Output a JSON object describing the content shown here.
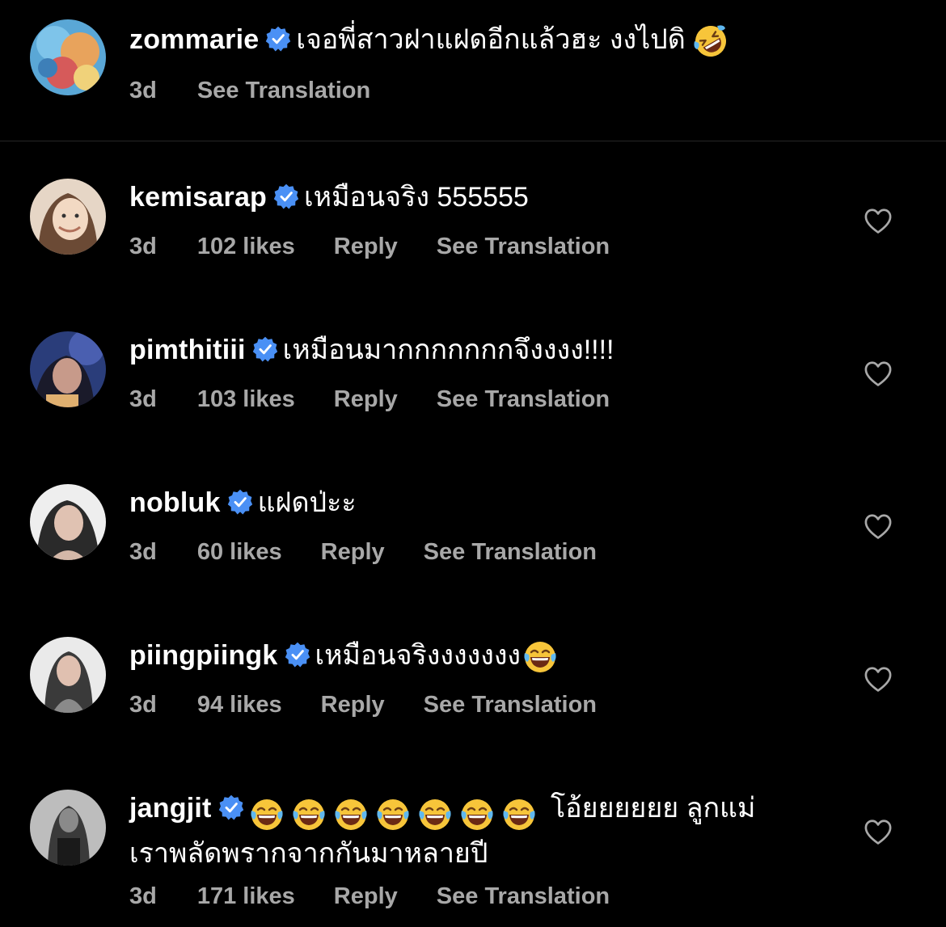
{
  "comments": [
    {
      "username": "zommarie",
      "text": "เจอพี่สาวฝาแฝดอีกแล้วฮะ งงไปดิ",
      "emoji": "rolling-on-floor-laughing-emoji",
      "time": "3d",
      "see_translation": "See Translation",
      "avatar_colors": [
        "#5aa7d6",
        "#e8a35c",
        "#d65a5a"
      ]
    },
    {
      "username": "kemisarap",
      "text": "เหมือนจริง 555555",
      "time": "3d",
      "likes": "102 likes",
      "reply": "Reply",
      "see_translation": "See Translation",
      "avatar_colors": [
        "#d9c7b8",
        "#f2e2d3",
        "#6b4a35"
      ]
    },
    {
      "username": "pimthitiii",
      "text": "เหมือนมากกกกกกกจึงงงง!!!!",
      "time": "3d",
      "likes": "103 likes",
      "reply": "Reply",
      "see_translation": "See Translation",
      "avatar_colors": [
        "#2a3d7a",
        "#c79a8a",
        "#4a5fb0"
      ]
    },
    {
      "username": "nobluk",
      "text": "แฝดป่ะะ",
      "time": "3d",
      "likes": "60 likes",
      "reply": "Reply",
      "see_translation": "See Translation",
      "avatar_colors": [
        "#e8e8e8",
        "#d4b8a8",
        "#2a2a2a"
      ]
    },
    {
      "username": "piingpiingk",
      "text": "เหมือนจริงงงงงงง",
      "emoji": "tears-of-joy-emoji",
      "time": "3d",
      "likes": "94 likes",
      "reply": "Reply",
      "see_translation": "See Translation",
      "avatar_colors": [
        "#eaeaea",
        "#c9a89a",
        "#3a3a3a"
      ]
    },
    {
      "username": "jangjit",
      "emoji_count": 7,
      "text": "โอ้ยยยยยย ลูกแม่เราพลัดพรากจากกันมาหลายปี",
      "time": "3d",
      "likes": "171 likes",
      "reply": "Reply",
      "see_translation": "See Translation",
      "avatar_colors": [
        "#bdbdbd",
        "#3a3a3a",
        "#7a7a7a"
      ]
    }
  ],
  "colors": {
    "background": "#000000",
    "meta": "#a8a8a8",
    "verified": "#4a90f5",
    "divider": "#262626"
  },
  "icons": {
    "verified": "verified-badge-icon",
    "like": "heart-outline-icon"
  }
}
